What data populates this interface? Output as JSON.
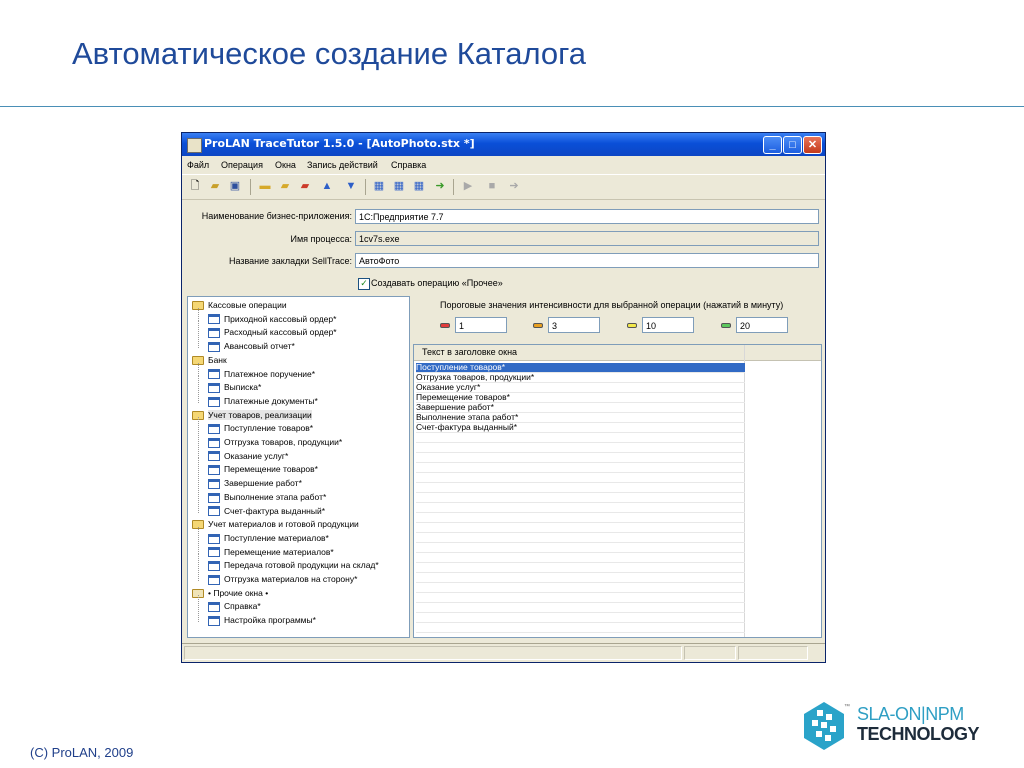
{
  "slide": {
    "title": "Автоматическое создание Каталога",
    "footer": "(C) ProLAN, 2009",
    "logo": {
      "line1": "SLA-ON|NPM",
      "line2": "TECHNOLOGY",
      "tm": "™"
    }
  },
  "window": {
    "title": "ProLAN TraceTutor 1.5.0 - [AutoPhoto.stx *]",
    "buttons": {
      "minimize": "_",
      "maximize": "□",
      "close": "✕"
    },
    "menu": [
      "Файл",
      "Операция",
      "Окна",
      "Запись действий",
      "Справка"
    ],
    "toolbar_icons": [
      "new-icon",
      "open-icon",
      "save-icon",
      "folder-new-icon",
      "folder-open-icon",
      "folder-delete-icon",
      "arrow-up-icon",
      "arrow-down-icon",
      "grid-icon",
      "grid-edit-icon",
      "grid-check-icon",
      "export-icon",
      "play-icon",
      "stop-icon",
      "record-icon"
    ]
  },
  "form": {
    "app_name_label": "Наименование бизнес-приложения:",
    "app_name_value": "1С:Предприятие 7.7",
    "process_label": "Имя процесса:",
    "process_value": "1cv7s.exe",
    "tab_label": "Название закладки SellTrace:",
    "tab_value": "АвтоФото",
    "create_other_checked": true,
    "create_other_label": "Создавать операцию «Прочее»"
  },
  "tree": [
    {
      "type": "group",
      "label": "Кассовые операции"
    },
    {
      "type": "item",
      "label": "Приходной кассовый ордер*"
    },
    {
      "type": "item",
      "label": "Расходный кассовый ордер*"
    },
    {
      "type": "item",
      "label": "Авансовый отчет*"
    },
    {
      "type": "group",
      "label": "Банк"
    },
    {
      "type": "item",
      "label": "Платежное поручение*"
    },
    {
      "type": "item",
      "label": "Выписка*"
    },
    {
      "type": "item",
      "label": "Платежные документы*"
    },
    {
      "type": "group",
      "label": "Учет товаров, реализации",
      "selected": true
    },
    {
      "type": "item",
      "label": "Поступление товаров*"
    },
    {
      "type": "item",
      "label": "Отгрузка товаров, продукции*"
    },
    {
      "type": "item",
      "label": "Оказание услуг*"
    },
    {
      "type": "item",
      "label": "Перемещение товаров*"
    },
    {
      "type": "item",
      "label": "Завершение работ*"
    },
    {
      "type": "item",
      "label": "Выполнение этапа работ*"
    },
    {
      "type": "item",
      "label": "Счет-фактура выданный*"
    },
    {
      "type": "group",
      "label": "Учет материалов и готовой продукции"
    },
    {
      "type": "item",
      "label": "Поступление материалов*"
    },
    {
      "type": "item",
      "label": "Перемещение материалов*"
    },
    {
      "type": "item",
      "label": "Передача готовой продукции на склад*"
    },
    {
      "type": "item",
      "label": "Отгрузка материалов на сторону*"
    },
    {
      "type": "other",
      "label": "• Прочие окна •"
    },
    {
      "type": "item",
      "label": "Справка*"
    },
    {
      "type": "item",
      "label": "Настройка программы*"
    }
  ],
  "thresholds": {
    "title": "Пороговые значения интенсивности для выбранной операции (нажатий в минуту)",
    "values": [
      "1",
      "3",
      "10",
      "20"
    ],
    "colors": [
      "#e23b3b",
      "#e8a020",
      "#f2e84a",
      "#5cc85c"
    ]
  },
  "grid": {
    "header": "Текст в заголовке окна",
    "rows": [
      "Поступление товаров*",
      "Отгрузка товаров, продукции*",
      "Оказание услуг*",
      "Перемещение товаров*",
      "Завершение работ*",
      "Выполнение этапа работ*",
      "Счет-фактура выданный*"
    ]
  }
}
